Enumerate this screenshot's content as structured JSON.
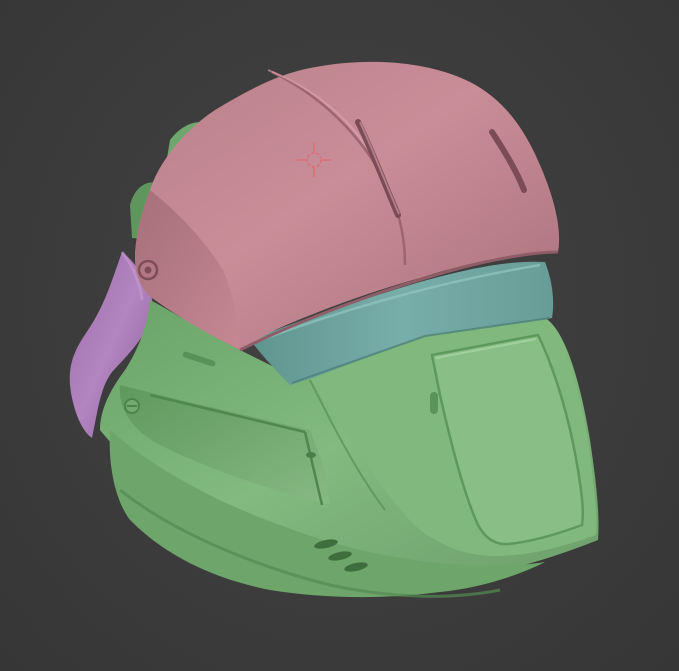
{
  "viewport": {
    "background": "#3b3b3b",
    "model": {
      "parts": [
        {
          "name": "helmet-top-shell",
          "color": "#c7848f"
        },
        {
          "name": "helmet-band",
          "color": "#72a7a2"
        },
        {
          "name": "helmet-face-guard",
          "color": "#7fb77c"
        },
        {
          "name": "helmet-visor-side",
          "color": "#a778b4"
        }
      ]
    },
    "cursor": {
      "icon": "crosshair-icon",
      "color": "#e06a74"
    }
  }
}
